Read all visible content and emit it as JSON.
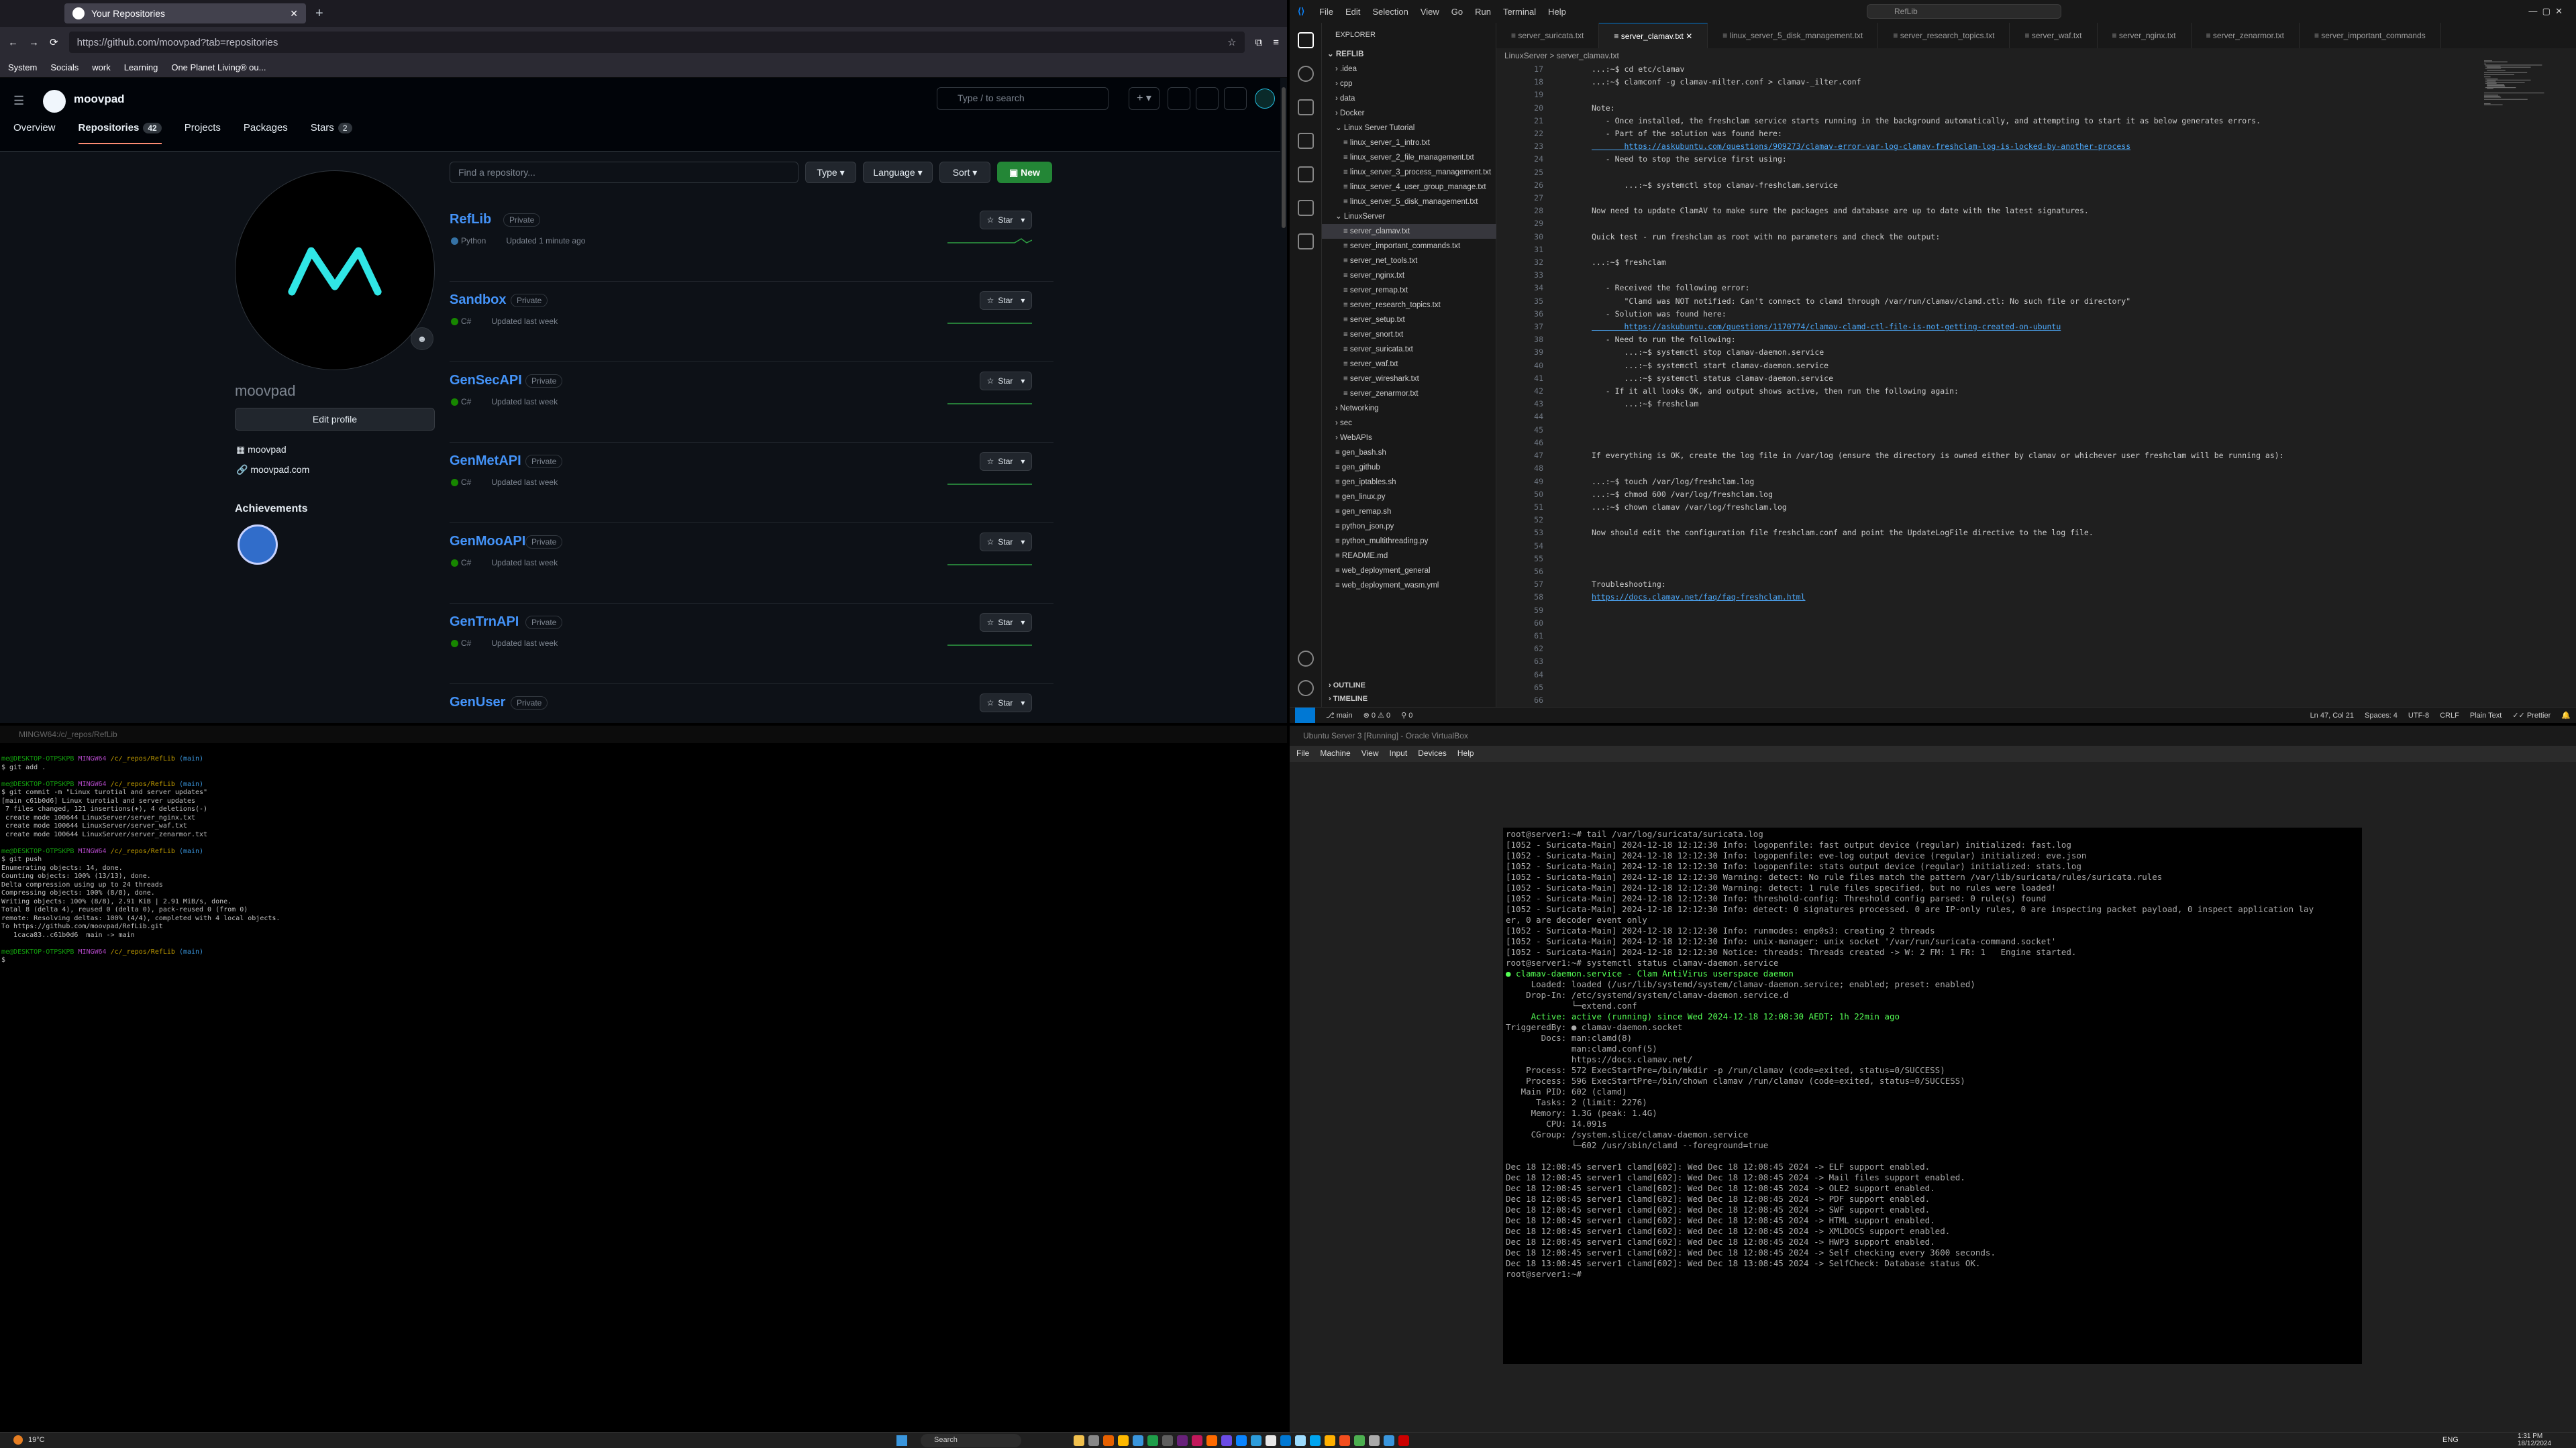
{
  "browser": {
    "tab_title": "Your Repositories",
    "url": "https://github.com/moovpad?tab=repositories",
    "bookmarks": [
      "System",
      "Socials",
      "work",
      "Learning",
      "One Planet Living® ou..."
    ]
  },
  "github": {
    "user": "moovpad",
    "search_placeholder": "Type / to search",
    "tabs": [
      {
        "label": "Overview",
        "count": ""
      },
      {
        "label": "Repositories",
        "count": "42"
      },
      {
        "label": "Projects",
        "count": ""
      },
      {
        "label": "Packages",
        "count": ""
      },
      {
        "label": "Stars",
        "count": "2"
      }
    ],
    "profile_name": "moovpad",
    "edit_profile": "Edit profile",
    "org": "moovpad",
    "website": "moovpad.com",
    "achievements": "Achievements",
    "find_placeholder": "Find a repository...",
    "filters": [
      "Type",
      "Language",
      "Sort"
    ],
    "new_label": "New",
    "repos": [
      {
        "name": "RefLib",
        "visibility": "Private",
        "lang": "Python",
        "lang_color": "#3572A5",
        "updated": "Updated 1 minute ago"
      },
      {
        "name": "Sandbox",
        "visibility": "Private",
        "lang": "C#",
        "lang_color": "#178600",
        "updated": "Updated last week"
      },
      {
        "name": "GenSecAPI",
        "visibility": "Private",
        "lang": "C#",
        "lang_color": "#178600",
        "updated": "Updated last week"
      },
      {
        "name": "GenMetAPI",
        "visibility": "Private",
        "lang": "C#",
        "lang_color": "#178600",
        "updated": "Updated last week"
      },
      {
        "name": "GenMooAPI",
        "visibility": "Private",
        "lang": "C#",
        "lang_color": "#178600",
        "updated": "Updated last week"
      },
      {
        "name": "GenTrnAPI",
        "visibility": "Private",
        "lang": "C#",
        "lang_color": "#178600",
        "updated": "Updated last week"
      },
      {
        "name": "GenUser",
        "visibility": "Private",
        "lang": "",
        "lang_color": "",
        "updated": ""
      }
    ],
    "star_label": "Star"
  },
  "gitbash": {
    "title": "MINGW64:/c/_repos/RefLib",
    "lines": [
      {
        "t": "prompt",
        "user": "me@DESKTOP-OTPSKPB",
        "sys": "MINGW64",
        "path": "/c/_repos/RefLib",
        "branch": "(main)"
      },
      {
        "t": "text",
        "v": "$ git add ."
      },
      {
        "t": "text",
        "v": ""
      },
      {
        "t": "prompt",
        "user": "me@DESKTOP-OTPSKPB",
        "sys": "MINGW64",
        "path": "/c/_repos/RefLib",
        "branch": "(main)"
      },
      {
        "t": "text",
        "v": "$ git commit -m \"Linux turotial and server updates\""
      },
      {
        "t": "text",
        "v": "[main c61b0d6] Linux turotial and server updates"
      },
      {
        "t": "text",
        "v": " 7 files changed, 121 insertions(+), 4 deletions(-)"
      },
      {
        "t": "text",
        "v": " create mode 100644 LinuxServer/server_nginx.txt"
      },
      {
        "t": "text",
        "v": " create mode 100644 LinuxServer/server_waf.txt"
      },
      {
        "t": "text",
        "v": " create mode 100644 LinuxServer/server_zenarmor.txt"
      },
      {
        "t": "text",
        "v": ""
      },
      {
        "t": "prompt",
        "user": "me@DESKTOP-OTPSKPB",
        "sys": "MINGW64",
        "path": "/c/_repos/RefLib",
        "branch": "(main)"
      },
      {
        "t": "text",
        "v": "$ git push"
      },
      {
        "t": "text",
        "v": "Enumerating objects: 14, done."
      },
      {
        "t": "text",
        "v": "Counting objects: 100% (13/13), done."
      },
      {
        "t": "text",
        "v": "Delta compression using up to 24 threads"
      },
      {
        "t": "text",
        "v": "Compressing objects: 100% (8/8), done."
      },
      {
        "t": "text",
        "v": "Writing objects: 100% (8/8), 2.91 KiB | 2.91 MiB/s, done."
      },
      {
        "t": "text",
        "v": "Total 8 (delta 4), reused 0 (delta 0), pack-reused 0 (from 0)"
      },
      {
        "t": "text",
        "v": "remote: Resolving deltas: 100% (4/4), completed with 4 local objects."
      },
      {
        "t": "text",
        "v": "To https://github.com/moovpad/RefLib.git"
      },
      {
        "t": "text",
        "v": "   1caca83..c61b0d6  main -> main"
      },
      {
        "t": "text",
        "v": ""
      },
      {
        "t": "prompt",
        "user": "me@DESKTOP-OTPSKPB",
        "sys": "MINGW64",
        "path": "/c/_repos/RefLib",
        "branch": "(main)"
      },
      {
        "t": "text",
        "v": "$ "
      }
    ]
  },
  "vscode": {
    "menu": [
      "File",
      "Edit",
      "Selection",
      "View",
      "Go",
      "Run",
      "Terminal",
      "Help"
    ],
    "command_center": "RefLib",
    "explorer_title": "EXPLORER",
    "tree": [
      {
        "label": "REFLIB",
        "indent": 0,
        "kind": "root"
      },
      {
        "label": ".idea",
        "indent": 1,
        "kind": "folder"
      },
      {
        "label": "cpp",
        "indent": 1,
        "kind": "folder"
      },
      {
        "label": "data",
        "indent": 1,
        "kind": "folder"
      },
      {
        "label": "Docker",
        "indent": 1,
        "kind": "folder"
      },
      {
        "label": "Linux Server Tutorial",
        "indent": 1,
        "kind": "open"
      },
      {
        "label": "linux_server_1_intro.txt",
        "indent": 2,
        "kind": "file"
      },
      {
        "label": "linux_server_2_file_management.txt",
        "indent": 2,
        "kind": "file"
      },
      {
        "label": "linux_server_3_process_management.txt",
        "indent": 2,
        "kind": "file"
      },
      {
        "label": "linux_server_4_user_group_manage.txt",
        "indent": 2,
        "kind": "file"
      },
      {
        "label": "linux_server_5_disk_management.txt",
        "indent": 2,
        "kind": "file"
      },
      {
        "label": "LinuxServer",
        "indent": 1,
        "kind": "open"
      },
      {
        "label": "server_clamav.txt",
        "indent": 2,
        "kind": "file",
        "sel": true
      },
      {
        "label": "server_important_commands.txt",
        "indent": 2,
        "kind": "file"
      },
      {
        "label": "server_net_tools.txt",
        "indent": 2,
        "kind": "file"
      },
      {
        "label": "server_nginx.txt",
        "indent": 2,
        "kind": "file"
      },
      {
        "label": "server_remap.txt",
        "indent": 2,
        "kind": "file"
      },
      {
        "label": "server_research_topics.txt",
        "indent": 2,
        "kind": "file"
      },
      {
        "label": "server_setup.txt",
        "indent": 2,
        "kind": "file"
      },
      {
        "label": "server_snort.txt",
        "indent": 2,
        "kind": "file"
      },
      {
        "label": "server_suricata.txt",
        "indent": 2,
        "kind": "file"
      },
      {
        "label": "server_waf.txt",
        "indent": 2,
        "kind": "file"
      },
      {
        "label": "server_wireshark.txt",
        "indent": 2,
        "kind": "file"
      },
      {
        "label": "server_zenarmor.txt",
        "indent": 2,
        "kind": "file"
      },
      {
        "label": "Networking",
        "indent": 1,
        "kind": "folder"
      },
      {
        "label": "sec",
        "indent": 1,
        "kind": "folder"
      },
      {
        "label": "WebAPIs",
        "indent": 1,
        "kind": "folder"
      },
      {
        "label": "gen_bash.sh",
        "indent": 1,
        "kind": "file"
      },
      {
        "label": "gen_github",
        "indent": 1,
        "kind": "file"
      },
      {
        "label": "gen_iptables.sh",
        "indent": 1,
        "kind": "file"
      },
      {
        "label": "gen_linux.py",
        "indent": 1,
        "kind": "file"
      },
      {
        "label": "gen_remap.sh",
        "indent": 1,
        "kind": "file"
      },
      {
        "label": "python_json.py",
        "indent": 1,
        "kind": "file"
      },
      {
        "label": "python_multithreading.py",
        "indent": 1,
        "kind": "file"
      },
      {
        "label": "README.md",
        "indent": 1,
        "kind": "file"
      },
      {
        "label": "web_deployment_general",
        "indent": 1,
        "kind": "file"
      },
      {
        "label": "web_deployment_wasm.yml",
        "indent": 1,
        "kind": "file"
      }
    ],
    "outline": "OUTLINE",
    "timeline": "TIMELINE",
    "tabs": [
      "server_suricata.txt",
      "server_clamav.txt",
      "linux_server_5_disk_management.txt",
      "server_research_topics.txt",
      "server_waf.txt",
      "server_nginx.txt",
      "server_zenarmor.txt",
      "server_important_commands"
    ],
    "active_tab": 1,
    "breadcrumb": "LinuxServer > server_clamav.txt",
    "first_line": 17,
    "code": [
      "...:~$ cd etc/clamav",
      "...:~$ clamconf -g clamav-milter.conf > clamav-_ilter.conf",
      "",
      "Note:",
      "   - Once installed, the freshclam service starts running in the background automatically, and attempting to start it as below generates errors.",
      "   - Part of the solution was found here:",
      "       https://askubuntu.com/questions/909273/clamav-error-var-log-clamav-freshclam-log-is-locked-by-another-process",
      "   - Need to stop the service first using:",
      "",
      "       ...:~$ systemctl stop clamav-freshclam.service",
      "",
      "Now need to update ClamAV to make sure the packages and database are up to date with the latest signatures.",
      "",
      "Quick test - run freshclam as root with no parameters and check the output:",
      "",
      "...:~$ freshclam",
      "",
      "   - Received the following error:",
      "       \"Clamd was NOT notified: Can't connect to clamd through /var/run/clamav/clamd.ctl: No such file or directory\"",
      "   - Solution was found here:",
      "       https://askubuntu.com/questions/1170774/clamav-clamd-ctl-file-is-not-getting-created-on-ubuntu",
      "   - Need to run the following:",
      "       ...:~$ systemctl stop clamav-daemon.service",
      "       ...:~$ systemctl start clamav-daemon.service",
      "       ...:~$ systemctl status clamav-daemon.service",
      "   - If it all looks OK, and output shows active, then run the following again:",
      "       ...:~$ freshclam",
      "",
      "",
      "",
      "If everything is OK, create the log file in /var/log (ensure the directory is owned either by clamav or whichever user freshclam will be running as):",
      "",
      "...:~$ touch /var/log/freshclam.log",
      "...:~$ chmod 600 /var/log/freshclam.log",
      "...:~$ chown clamav /var/log/freshclam.log",
      "",
      "Now should edit the configuration file freshclam.conf and point the UpdateLogFile directive to the log file.",
      "",
      "",
      "",
      "Troubleshooting:",
      "https://docs.clamav.net/faq/faq-freshclam.html",
      "",
      "",
      "",
      "",
      "",
      "",
      "",
      "",
      "",
      ""
    ],
    "status": {
      "branch": "main",
      "problems": "0 ⚠ 0",
      "ports": "0",
      "position": "Ln 47, Col 21",
      "spaces": "Spaces: 4",
      "encoding": "UTF-8",
      "eol": "CRLF",
      "language": "Plain Text",
      "prettier": "Prettier"
    }
  },
  "virtualbox": {
    "title": "Ubuntu Server 3 [Running] - Oracle VirtualBox",
    "menu": [
      "File",
      "Machine",
      "View",
      "Input",
      "Devices",
      "Help"
    ],
    "console": [
      "root@server1:~# tail /var/log/suricata/suricata.log",
      "[1052 - Suricata-Main] 2024-12-18 12:12:30 Info: logopenfile: fast output device (regular) initialized: fast.log",
      "[1052 - Suricata-Main] 2024-12-18 12:12:30 Info: logopenfile: eve-log output device (regular) initialized: eve.json",
      "[1052 - Suricata-Main] 2024-12-18 12:12:30 Info: logopenfile: stats output device (regular) initialized: stats.log",
      "[1052 - Suricata-Main] 2024-12-18 12:12:30 Warning: detect: No rule files match the pattern /var/lib/suricata/rules/suricata.rules",
      "[1052 - Suricata-Main] 2024-12-18 12:12:30 Warning: detect: 1 rule files specified, but no rules were loaded!",
      "[1052 - Suricata-Main] 2024-12-18 12:12:30 Info: threshold-config: Threshold config parsed: 0 rule(s) found",
      "[1052 - Suricata-Main] 2024-12-18 12:12:30 Info: detect: 0 signatures processed. 0 are IP-only rules, 0 are inspecting packet payload, 0 inspect application lay",
      "er, 0 are decoder event only",
      "[1052 - Suricata-Main] 2024-12-18 12:12:30 Info: runmodes: enp0s3: creating 2 threads",
      "[1052 - Suricata-Main] 2024-12-18 12:12:30 Info: unix-manager: unix socket '/var/run/suricata-command.socket'",
      "[1052 - Suricata-Main] 2024-12-18 12:12:30 Notice: threads: Threads created -> W: 2 FM: 1 FR: 1   Engine started.",
      "root@server1:~# systemctl status clamav-daemon.service",
      "● clamav-daemon.service - Clam AntiVirus userspace daemon",
      "     Loaded: loaded (/usr/lib/systemd/system/clamav-daemon.service; enabled; preset: enabled)",
      "    Drop-In: /etc/systemd/system/clamav-daemon.service.d",
      "             └─extend.conf",
      "     Active: active (running) since Wed 2024-12-18 12:08:30 AEDT; 1h 22min ago",
      "TriggeredBy: ● clamav-daemon.socket",
      "       Docs: man:clamd(8)",
      "             man:clamd.conf(5)",
      "             https://docs.clamav.net/",
      "    Process: 572 ExecStartPre=/bin/mkdir -p /run/clamav (code=exited, status=0/SUCCESS)",
      "    Process: 596 ExecStartPre=/bin/chown clamav /run/clamav (code=exited, status=0/SUCCESS)",
      "   Main PID: 602 (clamd)",
      "      Tasks: 2 (limit: 2276)",
      "     Memory: 1.3G (peak: 1.4G)",
      "        CPU: 14.091s",
      "     CGroup: /system.slice/clamav-daemon.service",
      "             └─602 /usr/sbin/clamd --foreground=true",
      "",
      "Dec 18 12:08:45 server1 clamd[602]: Wed Dec 18 12:08:45 2024 -> ELF support enabled.",
      "Dec 18 12:08:45 server1 clamd[602]: Wed Dec 18 12:08:45 2024 -> Mail files support enabled.",
      "Dec 18 12:08:45 server1 clamd[602]: Wed Dec 18 12:08:45 2024 -> OLE2 support enabled.",
      "Dec 18 12:08:45 server1 clamd[602]: Wed Dec 18 12:08:45 2024 -> PDF support enabled.",
      "Dec 18 12:08:45 server1 clamd[602]: Wed Dec 18 12:08:45 2024 -> SWF support enabled.",
      "Dec 18 12:08:45 server1 clamd[602]: Wed Dec 18 12:08:45 2024 -> HTML support enabled.",
      "Dec 18 12:08:45 server1 clamd[602]: Wed Dec 18 12:08:45 2024 -> XMLDOCS support enabled.",
      "Dec 18 12:08:45 server1 clamd[602]: Wed Dec 18 12:08:45 2024 -> HWP3 support enabled.",
      "Dec 18 12:08:45 server1 clamd[602]: Wed Dec 18 12:08:45 2024 -> Self checking every 3600 seconds.",
      "Dec 18 13:08:45 server1 clamd[602]: Wed Dec 18 13:08:45 2024 -> SelfCheck: Database status OK.",
      "root@server1:~# "
    ]
  },
  "taskbar": {
    "weather": "19°C",
    "search": "Search",
    "lang": "ENG",
    "time": "1:31 PM",
    "date": "18/12/2024"
  }
}
